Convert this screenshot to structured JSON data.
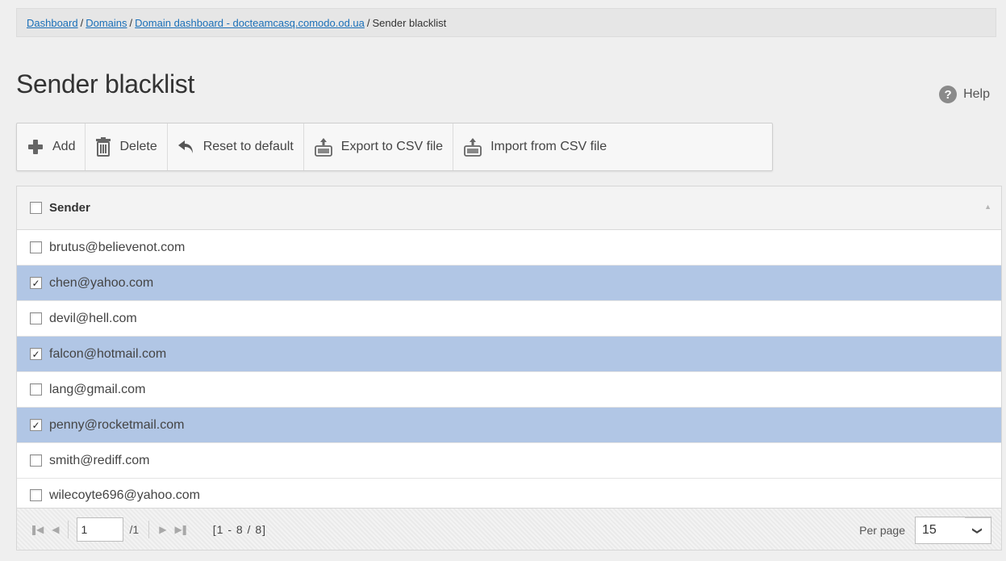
{
  "breadcrumb": {
    "items": [
      "Dashboard",
      "Domains",
      "Domain dashboard - docteamcasq.comodo.od.ua"
    ],
    "current": "Sender blacklist",
    "separator": "/"
  },
  "page": {
    "title": "Sender blacklist",
    "help_label": "Help",
    "help_icon_glyph": "?"
  },
  "toolbar": {
    "add": "Add",
    "delete": "Delete",
    "reset": "Reset to default",
    "export": "Export to CSV file",
    "import": "Import from CSV file"
  },
  "grid": {
    "column": "Sender",
    "rows": [
      {
        "sender": "brutus@believenot.com",
        "checked": false
      },
      {
        "sender": "chen@yahoo.com",
        "checked": true
      },
      {
        "sender": "devil@hell.com",
        "checked": false
      },
      {
        "sender": "falcon@hotmail.com",
        "checked": true
      },
      {
        "sender": "lang@gmail.com",
        "checked": false
      },
      {
        "sender": "penny@rocketmail.com",
        "checked": true
      },
      {
        "sender": "smith@rediff.com",
        "checked": false
      },
      {
        "sender": "wilecoyte696@yahoo.com",
        "checked": false
      }
    ]
  },
  "pager": {
    "page_value": "1",
    "of_pages": "/1",
    "range": "[1 - 8 / 8]",
    "per_page_label": "Per page",
    "per_page_value": "15"
  },
  "colors": {
    "link": "#1a6fb8",
    "selected_row": "#b1c6e5",
    "add_icon": "#666666"
  }
}
